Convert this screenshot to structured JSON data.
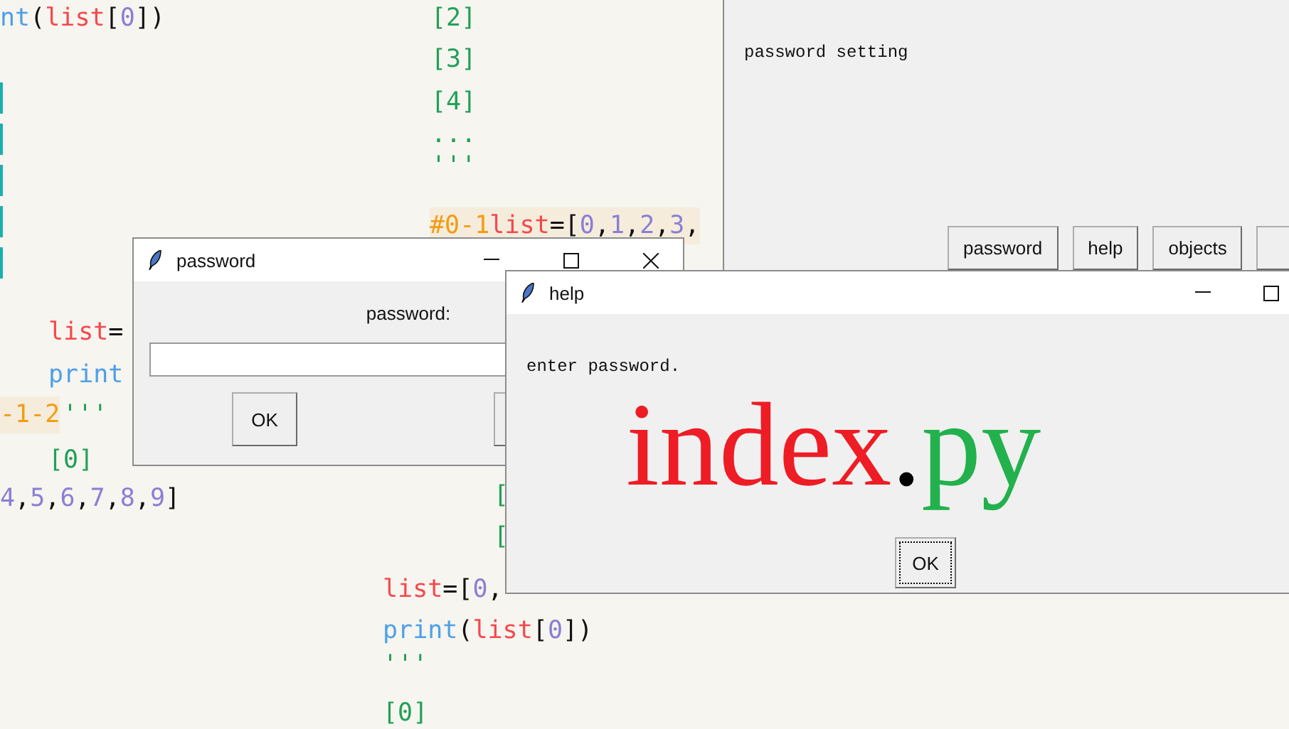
{
  "code_fragments": [
    {
      "tokens": [
        {
          "text": "nt",
          "kind": "func"
        },
        {
          "text": "(",
          "kind": "punct"
        },
        {
          "text": "list",
          "kind": "var"
        },
        {
          "text": "[",
          "kind": "punct"
        },
        {
          "text": "0",
          "kind": "num"
        },
        {
          "text": "])",
          "kind": "punct"
        }
      ]
    },
    {
      "tokens": [
        {
          "text": "[2]",
          "kind": "out"
        }
      ]
    },
    {
      "tokens": [
        {
          "text": "[3]",
          "kind": "out"
        }
      ]
    },
    {
      "tokens": [
        {
          "text": "[4]",
          "kind": "out"
        }
      ]
    },
    {
      "tokens": [
        {
          "text": "...",
          "kind": "out"
        }
      ]
    },
    {
      "tokens": [
        {
          "text": "'''",
          "kind": "out"
        }
      ]
    },
    {
      "highlighted": true,
      "tokens": [
        {
          "text": "#0-1",
          "kind": "comment"
        },
        {
          "text": "list",
          "kind": "var"
        },
        {
          "text": "=[",
          "kind": "punct"
        },
        {
          "text": "0",
          "kind": "num"
        },
        {
          "text": ",",
          "kind": "punct"
        },
        {
          "text": "1",
          "kind": "num"
        },
        {
          "text": ",",
          "kind": "punct"
        },
        {
          "text": "2",
          "kind": "num"
        },
        {
          "text": ",",
          "kind": "punct"
        },
        {
          "text": "3",
          "kind": "num"
        },
        {
          "text": ",",
          "kind": "punct"
        }
      ]
    },
    {
      "tokens": [
        {
          "text": "list",
          "kind": "var"
        },
        {
          "text": "=",
          "kind": "punct"
        }
      ]
    },
    {
      "tokens": [
        {
          "text": "print",
          "kind": "func"
        }
      ]
    },
    {
      "highlighted": true,
      "tokens": [
        {
          "text": "-1-2",
          "kind": "comment"
        }
      ]
    },
    {
      "tokens": [
        {
          "text": "'''",
          "kind": "out"
        }
      ]
    },
    {
      "tokens": [
        {
          "text": "[0]",
          "kind": "out"
        }
      ]
    },
    {
      "tokens": [
        {
          "text": "4",
          "kind": "num"
        },
        {
          "text": ",",
          "kind": "punct"
        },
        {
          "text": "5",
          "kind": "num"
        },
        {
          "text": ",",
          "kind": "punct"
        },
        {
          "text": "6",
          "kind": "num"
        },
        {
          "text": ",",
          "kind": "punct"
        },
        {
          "text": "7",
          "kind": "num"
        },
        {
          "text": ",",
          "kind": "punct"
        },
        {
          "text": "8",
          "kind": "num"
        },
        {
          "text": ",",
          "kind": "punct"
        },
        {
          "text": "9",
          "kind": "num"
        },
        {
          "text": "]",
          "kind": "punct"
        }
      ]
    },
    {
      "tokens": [
        {
          "text": "[",
          "kind": "out"
        }
      ]
    },
    {
      "tokens": [
        {
          "text": "[",
          "kind": "out"
        }
      ]
    },
    {
      "tokens": [
        {
          "text": "list",
          "kind": "var"
        },
        {
          "text": "=[",
          "kind": "punct"
        },
        {
          "text": "0",
          "kind": "num"
        },
        {
          "text": ",",
          "kind": "punct"
        }
      ]
    },
    {
      "tokens": [
        {
          "text": "print",
          "kind": "func"
        },
        {
          "text": "(",
          "kind": "punct"
        },
        {
          "text": "list",
          "kind": "var"
        },
        {
          "text": "[",
          "kind": "punct"
        },
        {
          "text": "0",
          "kind": "num"
        },
        {
          "text": "])",
          "kind": "punct"
        }
      ]
    },
    {
      "tokens": [
        {
          "text": "'''",
          "kind": "out"
        }
      ]
    },
    {
      "tokens": [
        {
          "text": "[0]",
          "kind": "out"
        }
      ]
    }
  ],
  "main_window": {
    "label": "password setting",
    "buttons": [
      "password",
      "help",
      "objects"
    ]
  },
  "password_dialog": {
    "title": "password",
    "field_label": "password:",
    "buttons": [
      "OK"
    ]
  },
  "help_dialog": {
    "title": "help",
    "message": "enter password.",
    "button": {
      "label": "OK",
      "focused": true
    }
  },
  "overlay_title": [
    {
      "text": "index",
      "color": "#ee1c25"
    },
    {
      "text": ".",
      "color": "#000000"
    },
    {
      "text": "py",
      "color": "#22b14c"
    }
  ]
}
